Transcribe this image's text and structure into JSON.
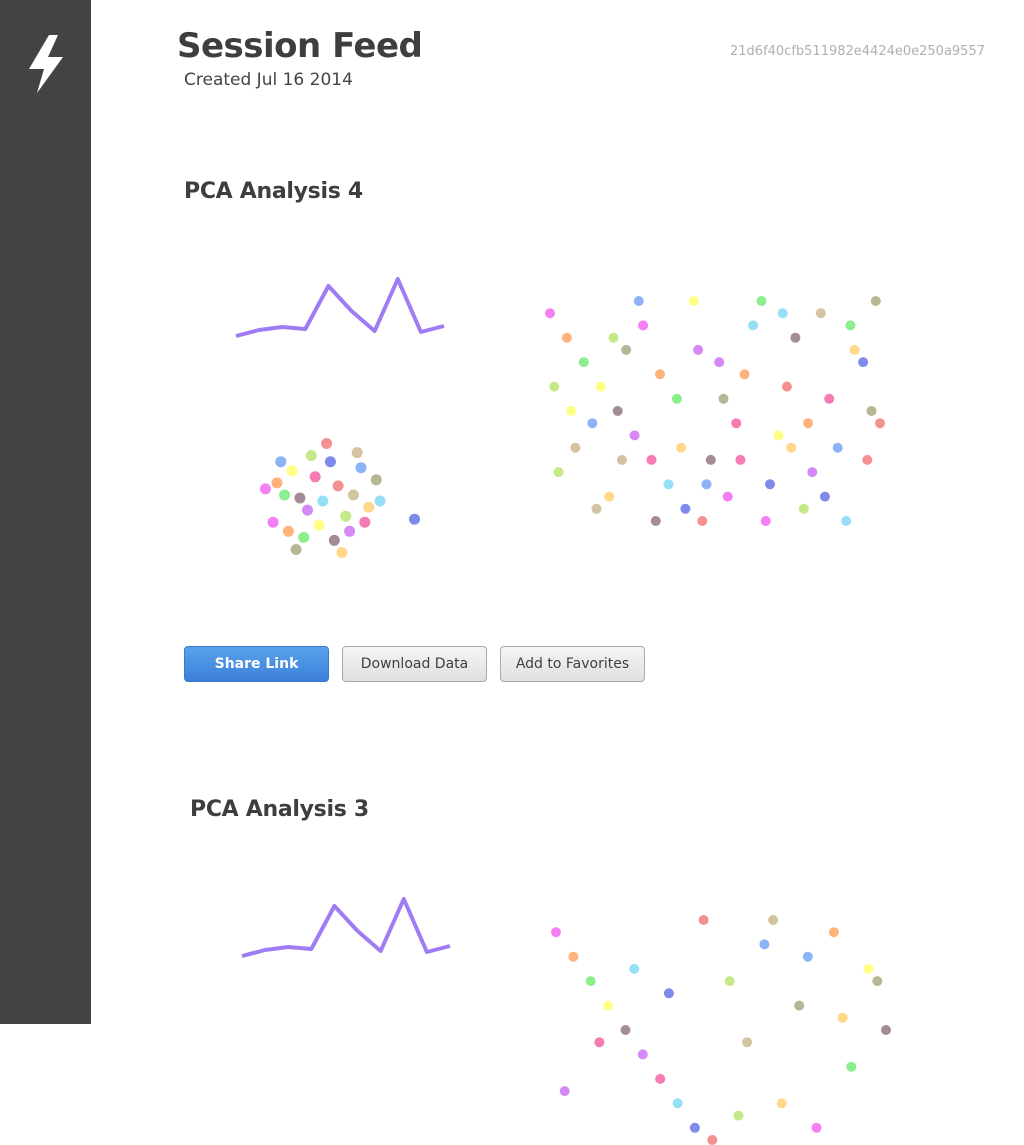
{
  "page": {
    "title": "Session Feed",
    "created": "Created Jul 16 2014",
    "session_id": "21d6f40cfb511982e4424e0e250a9557"
  },
  "sidebar": {
    "logo_icon": "lightning-bolt-icon",
    "background": "#434343"
  },
  "cards": [
    {
      "title": "PCA Analysis 4",
      "actions": {
        "share_label": "Share Link",
        "download_label": "Download Data",
        "favorite_label": "Add to Favorites"
      }
    },
    {
      "title": "PCA Analysis 3"
    }
  ],
  "colors": {
    "accent": "#3b7fd9",
    "line": "#a07cf4",
    "marker_palette": [
      "#f25ff2",
      "#ffa05a",
      "#6fea6f",
      "#ffff66",
      "#8c6e7e",
      "#c96cf5",
      "#f25a9f",
      "#7dd6f5",
      "#5f6ee6",
      "#f27474",
      "#b7e36a",
      "#c8b48a",
      "#6fa0f2",
      "#ffd06b",
      "#a6a57a"
    ]
  },
  "chart_data": [
    {
      "type": "line",
      "y": [
        8,
        14,
        17,
        15,
        58,
        33,
        13,
        65,
        12,
        18
      ]
    },
    {
      "type": "scatter",
      "note": "colored clusters",
      "points": [
        {
          "x": -1.5,
          "y": 0.5
        },
        {
          "x": -1.2,
          "y": 0.7
        },
        {
          "x": -1.0,
          "y": 0.3
        },
        {
          "x": -0.8,
          "y": 1.1
        },
        {
          "x": -0.6,
          "y": 0.2
        },
        {
          "x": -0.4,
          "y": -0.2
        },
        {
          "x": -0.2,
          "y": 0.9
        },
        {
          "x": 0.0,
          "y": 0.1
        },
        {
          "x": 0.2,
          "y": 1.4
        },
        {
          "x": 0.4,
          "y": 0.6
        },
        {
          "x": 0.6,
          "y": -0.4
        },
        {
          "x": 0.8,
          "y": 0.3
        },
        {
          "x": 1.0,
          "y": 1.2
        },
        {
          "x": 1.2,
          "y": -0.1
        },
        {
          "x": 1.4,
          "y": 0.8
        },
        {
          "x": -1.3,
          "y": -0.6
        },
        {
          "x": -0.9,
          "y": -0.9
        },
        {
          "x": -0.5,
          "y": -1.1
        },
        {
          "x": -0.1,
          "y": -0.7
        },
        {
          "x": 0.3,
          "y": -1.2
        },
        {
          "x": 0.7,
          "y": -0.9
        },
        {
          "x": 1.1,
          "y": -0.6
        },
        {
          "x": 1.5,
          "y": 0.1
        },
        {
          "x": 2.4,
          "y": -0.5
        },
        {
          "x": 0.1,
          "y": 2.0
        },
        {
          "x": -0.3,
          "y": 1.6
        },
        {
          "x": 0.9,
          "y": 1.7
        },
        {
          "x": -1.1,
          "y": 1.4
        },
        {
          "x": 0.5,
          "y": -1.6
        },
        {
          "x": -0.7,
          "y": -1.5
        }
      ]
    },
    {
      "type": "scatter",
      "note": "scattered markers",
      "points": [
        {
          "x": 1,
          "y": 18
        },
        {
          "x": 3,
          "y": 16
        },
        {
          "x": 5,
          "y": 14
        },
        {
          "x": 7,
          "y": 12
        },
        {
          "x": 9,
          "y": 10
        },
        {
          "x": 11,
          "y": 8
        },
        {
          "x": 13,
          "y": 6
        },
        {
          "x": 15,
          "y": 4
        },
        {
          "x": 17,
          "y": 2
        },
        {
          "x": 19,
          "y": 1
        },
        {
          "x": 2,
          "y": 5
        },
        {
          "x": 4,
          "y": 7
        },
        {
          "x": 6,
          "y": 9
        },
        {
          "x": 8,
          "y": 3
        },
        {
          "x": 10,
          "y": 15
        },
        {
          "x": 12,
          "y": 17
        },
        {
          "x": 14,
          "y": 13
        },
        {
          "x": 16,
          "y": 11
        },
        {
          "x": 18,
          "y": 19
        },
        {
          "x": 20,
          "y": 6
        },
        {
          "x": 21,
          "y": 14
        },
        {
          "x": 23,
          "y": 9
        },
        {
          "x": 25,
          "y": 17
        },
        {
          "x": 27,
          "y": 4
        },
        {
          "x": 29,
          "y": 12
        },
        {
          "x": 31,
          "y": 2
        },
        {
          "x": 33,
          "y": 18
        },
        {
          "x": 35,
          "y": 7
        },
        {
          "x": 37,
          "y": 15
        },
        {
          "x": 39,
          "y": 10
        },
        {
          "x": 22,
          "y": 3
        },
        {
          "x": 24,
          "y": 13
        },
        {
          "x": 26,
          "y": 19
        },
        {
          "x": 28,
          "y": 8
        },
        {
          "x": 30,
          "y": 16
        },
        {
          "x": 32,
          "y": 5
        },
        {
          "x": 34,
          "y": 11
        },
        {
          "x": 36,
          "y": 1
        },
        {
          "x": 38,
          "y": 14
        },
        {
          "x": 40,
          "y": 9
        },
        {
          "x": 1.5,
          "y": 12
        },
        {
          "x": 6.5,
          "y": 2
        },
        {
          "x": 11.5,
          "y": 19
        },
        {
          "x": 16.5,
          "y": 7
        },
        {
          "x": 21.5,
          "y": 11
        },
        {
          "x": 26.5,
          "y": 1
        },
        {
          "x": 31.5,
          "y": 9
        },
        {
          "x": 36.5,
          "y": 17
        },
        {
          "x": 3.5,
          "y": 10
        },
        {
          "x": 13.5,
          "y": 1
        },
        {
          "x": 18.5,
          "y": 15
        },
        {
          "x": 23.5,
          "y": 6
        },
        {
          "x": 28.5,
          "y": 18
        },
        {
          "x": 33.5,
          "y": 3
        },
        {
          "x": 38.5,
          "y": 6
        },
        {
          "x": 8.5,
          "y": 16
        },
        {
          "x": 9.5,
          "y": 6
        },
        {
          "x": 19.5,
          "y": 4
        },
        {
          "x": 29.5,
          "y": 7
        },
        {
          "x": 39.5,
          "y": 19
        }
      ]
    },
    {
      "type": "line",
      "y": [
        8,
        14,
        17,
        15,
        58,
        33,
        13,
        65,
        12,
        18
      ]
    },
    {
      "type": "scatter",
      "note": "scattered markers",
      "points": [
        {
          "x": 1,
          "y": 18
        },
        {
          "x": 3,
          "y": 16
        },
        {
          "x": 5,
          "y": 14
        },
        {
          "x": 7,
          "y": 12
        },
        {
          "x": 9,
          "y": 10
        },
        {
          "x": 11,
          "y": 8
        },
        {
          "x": 13,
          "y": 6
        },
        {
          "x": 15,
          "y": 4
        },
        {
          "x": 17,
          "y": 2
        },
        {
          "x": 19,
          "y": 1
        },
        {
          "x": 21,
          "y": 14
        },
        {
          "x": 23,
          "y": 9
        },
        {
          "x": 25,
          "y": 17
        },
        {
          "x": 27,
          "y": 4
        },
        {
          "x": 29,
          "y": 12
        },
        {
          "x": 31,
          "y": 2
        },
        {
          "x": 33,
          "y": 18
        },
        {
          "x": 35,
          "y": 7
        },
        {
          "x": 37,
          "y": 15
        },
        {
          "x": 39,
          "y": 10
        },
        {
          "x": 2,
          "y": 5
        },
        {
          "x": 6,
          "y": 9
        },
        {
          "x": 10,
          "y": 15
        },
        {
          "x": 14,
          "y": 13
        },
        {
          "x": 18,
          "y": 19
        },
        {
          "x": 22,
          "y": 3
        },
        {
          "x": 26,
          "y": 19
        },
        {
          "x": 30,
          "y": 16
        },
        {
          "x": 34,
          "y": 11
        },
        {
          "x": 38,
          "y": 14
        }
      ]
    }
  ]
}
